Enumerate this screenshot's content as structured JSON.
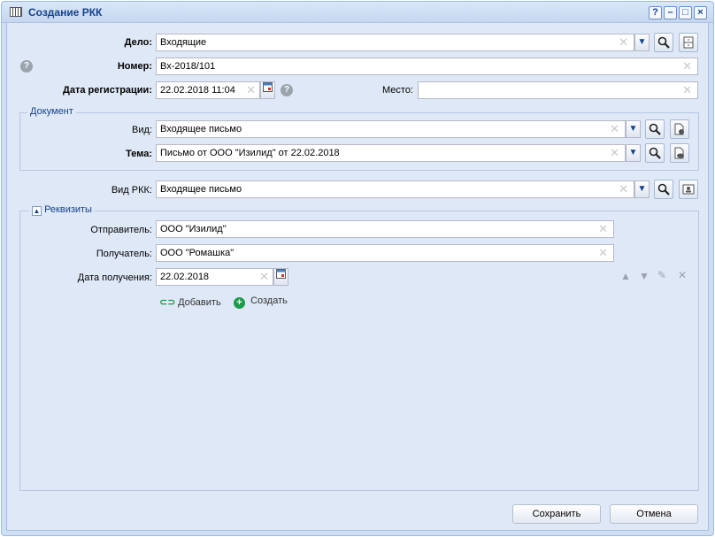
{
  "window": {
    "title": "Создание РКК",
    "help": "?",
    "minimize": "–",
    "maximize": "□",
    "close": "×"
  },
  "form": {
    "delo_label": "Дело:",
    "delo_value": "Входящие",
    "nomer_label": "Номер:",
    "nomer_value": "Вх-2018/101",
    "datereg_label": "Дата регистрации:",
    "datereg_value": "22.02.2018 11:04",
    "mesto_label": "Место:",
    "mesto_value": "",
    "help_icon": "?"
  },
  "document": {
    "legend": "Документ",
    "vid_label": "Вид:",
    "vid_value": "Входящее письмо",
    "tema_label": "Тема:",
    "tema_value": "Письмо от ООО \"Изилид\" от 22.02.2018"
  },
  "rkk": {
    "vid_label": "Вид РКК:",
    "vid_value": "Входящее письмо"
  },
  "rekvizity": {
    "legend": "Реквизиты",
    "sender_label": "Отправитель:",
    "sender_value": "ООО \"Изилид\"",
    "receiver_label": "Получатель:",
    "receiver_value": "ООО \"Ромашка\"",
    "date_label": "Дата получения:",
    "date_value": "22.02.2018",
    "add_label": "Добавить",
    "create_label": "Создать"
  },
  "footer": {
    "save_label": "Сохранить",
    "cancel_label": "Отмена"
  },
  "colors": {
    "title": "#15428b",
    "panel": "#dfe8f6",
    "create_icon": "#1a9c4a"
  }
}
